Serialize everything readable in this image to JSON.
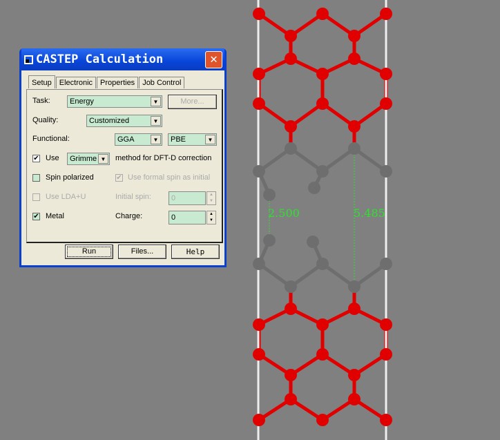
{
  "viewer": {
    "measurements": [
      "2.500",
      "5.485"
    ],
    "colors": {
      "oxygen": "#e00000",
      "carbon": "#6e6e6e",
      "measure": "#30e030"
    }
  },
  "dialog": {
    "title": "CASTEP Calculation",
    "tabs": [
      "Setup",
      "Electronic",
      "Properties",
      "Job Control"
    ],
    "task_label": "Task:",
    "task_value": "Energy",
    "more_button": "More...",
    "quality_label": "Quality:",
    "quality_value": "Customized",
    "functional_label": "Functional:",
    "functional_value": "GGA",
    "functional_sub": "PBE",
    "use_label": "Use",
    "use_checked": true,
    "dispersion_value": "Grimme",
    "dispersion_suffix": "method for DFT-D correction",
    "spin_polarized": "Spin polarized",
    "formal_spin": "Use formal spin as initial",
    "lda_u": "Use LDA+U",
    "initial_spin_label": "Initial spin:",
    "initial_spin_value": "0",
    "metal": "Metal",
    "metal_checked": true,
    "charge_label": "Charge:",
    "charge_value": "0",
    "run_button": "Run",
    "files_button": "Files...",
    "help_button": "Help"
  }
}
